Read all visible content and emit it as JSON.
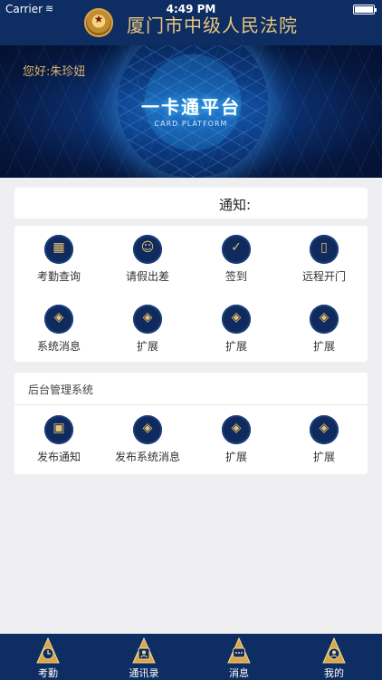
{
  "status_bar": {
    "carrier": "Carrier",
    "time": "4:49 PM"
  },
  "header": {
    "title": "厦门市中级人民法院"
  },
  "banner": {
    "greeting_prefix": "您好:",
    "user_name": "朱珍妞",
    "title": "一卡通平台",
    "subtitle": "CARD PLATFORM"
  },
  "notice": {
    "label": "通知:"
  },
  "main_grid": [
    {
      "label": "考勤查询",
      "icon": "attendance-query-icon",
      "glyph": "▦"
    },
    {
      "label": "请假出差",
      "icon": "leave-request-icon",
      "glyph": "☺"
    },
    {
      "label": "签到",
      "icon": "sign-in-icon",
      "glyph": "✓"
    },
    {
      "label": "远程开门",
      "icon": "remote-door-icon",
      "glyph": "▯"
    },
    {
      "label": "系统消息",
      "icon": "system-message-icon",
      "glyph": "◈"
    },
    {
      "label": "扩展",
      "icon": "extension-icon",
      "glyph": "◈"
    },
    {
      "label": "扩展",
      "icon": "extension-icon",
      "glyph": "◈"
    },
    {
      "label": "扩展",
      "icon": "extension-icon",
      "glyph": "◈"
    }
  ],
  "admin": {
    "header": "后台管理系统",
    "items": [
      {
        "label": "发布通知",
        "icon": "publish-notice-icon",
        "glyph": "▣"
      },
      {
        "label": "发布系统消息",
        "icon": "publish-system-message-icon",
        "glyph": "◈"
      },
      {
        "label": "扩展",
        "icon": "extension-icon",
        "glyph": "◈"
      },
      {
        "label": "扩展",
        "icon": "extension-icon",
        "glyph": "◈"
      }
    ]
  },
  "tabbar": [
    {
      "label": "考勤",
      "icon": "attendance-tab-icon"
    },
    {
      "label": "通讯录",
      "icon": "contacts-tab-icon"
    },
    {
      "label": "消息",
      "icon": "message-tab-icon"
    },
    {
      "label": "我的",
      "icon": "profile-tab-icon"
    }
  ],
  "colors": {
    "navy": "#0e2d62",
    "gold": "#e7c173",
    "background": "#efeff1"
  }
}
